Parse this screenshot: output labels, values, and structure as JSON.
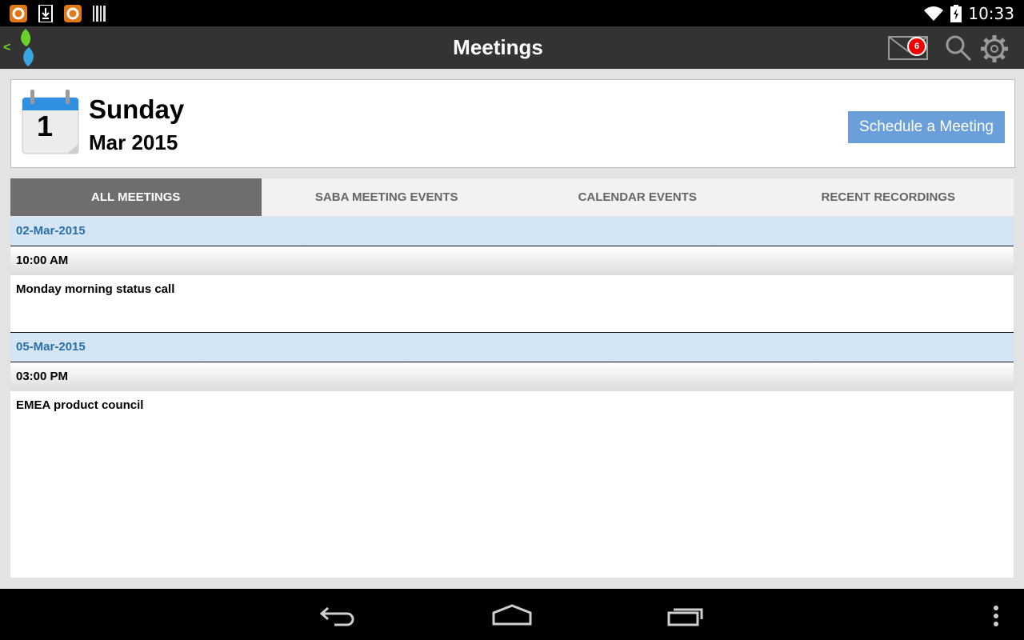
{
  "status_bar": {
    "time": "10:33",
    "icons": [
      "notification-app-icon",
      "download-icon",
      "notification-app-icon",
      "barcode-icon",
      "wifi-icon",
      "battery-icon"
    ]
  },
  "action_bar": {
    "title": "Meetings",
    "unread_count": "6",
    "icons": [
      "app-logo-icon",
      "mail-icon",
      "search-icon",
      "gear-icon"
    ]
  },
  "header": {
    "calendar_day": "1",
    "day_name": "Sunday",
    "month_year": "Mar 2015",
    "schedule_button": "Schedule a Meeting"
  },
  "tabs": [
    {
      "label": "ALL MEETINGS",
      "active": true
    },
    {
      "label": "SABA MEETING EVENTS",
      "active": false
    },
    {
      "label": "CALENDAR EVENTS",
      "active": false
    },
    {
      "label": "RECENT RECORDINGS",
      "active": false
    }
  ],
  "meetings": [
    {
      "date": "02-Mar-2015",
      "time": "10:00 AM",
      "title": "Monday morning status call"
    },
    {
      "date": "05-Mar-2015",
      "time": "03:00 PM",
      "title": "EMEA product council"
    }
  ],
  "colors": {
    "accent": "#6a9fd9",
    "date_header_bg": "#d4e6f5",
    "date_header_text": "#2c6fa8",
    "active_tab": "#6e6e6e",
    "action_bar": "#333333",
    "badge": "#ee0000"
  },
  "nav_bar": {
    "icons": [
      "back-icon",
      "home-icon",
      "recent-apps-icon",
      "overflow-menu-icon"
    ]
  }
}
